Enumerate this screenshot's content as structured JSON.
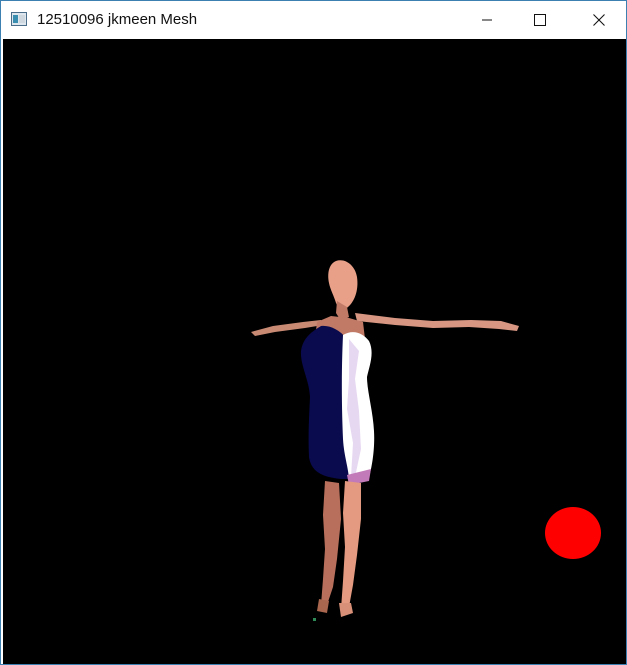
{
  "window": {
    "title": "12510096 jkmeen Mesh",
    "controls": {
      "minimize": "minimize",
      "maximize": "maximize",
      "close": "close"
    }
  },
  "icons": {
    "app": "app-window-icon",
    "minimize": "minimize-icon",
    "maximize": "maximize-icon",
    "close": "close-icon"
  },
  "scene": {
    "background_color": "#000000",
    "light_sphere_color": "#ff0000",
    "skin_color": "#e8a088",
    "dress_lit_color": "#ffffff",
    "dress_shadow_color": "#0a0a4e"
  }
}
